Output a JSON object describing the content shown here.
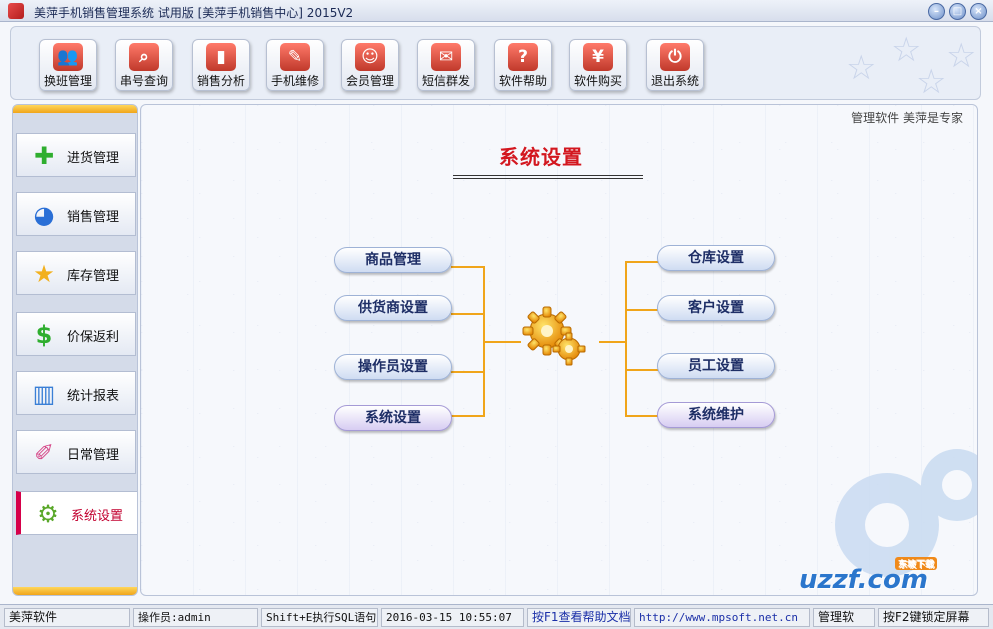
{
  "window": {
    "title": "美萍手机销售管理系统 试用版 [美萍手机销售中心] 2015V2",
    "buttons": {
      "minimize": "–",
      "restore": "□",
      "close": "×"
    }
  },
  "toolbar": {
    "items": [
      {
        "label": "换班管理",
        "icon": "users-icon",
        "glyph": "👥",
        "color": "#c0392b"
      },
      {
        "label": "串号查询",
        "icon": "search-icon",
        "glyph": "⌕",
        "color": "#c0392b"
      },
      {
        "label": "销售分析",
        "icon": "bar-chart-icon",
        "glyph": "▮",
        "color": "#c0392b"
      },
      {
        "label": "手机维修",
        "icon": "wrench-icon",
        "glyph": "✎",
        "color": "#c0392b"
      },
      {
        "label": "会员管理",
        "icon": "member-icon",
        "glyph": "☺",
        "color": "#c0392b"
      },
      {
        "label": "短信群发",
        "icon": "envelope-icon",
        "glyph": "✉",
        "color": "#c0392b"
      },
      {
        "label": "软件帮助",
        "icon": "help-icon",
        "glyph": "?",
        "color": "#c0392b"
      },
      {
        "label": "软件购买",
        "icon": "yen-icon",
        "glyph": "¥",
        "color": "#c0392b"
      },
      {
        "label": "退出系统",
        "icon": "power-icon",
        "glyph": "⏻",
        "color": "#c0392b"
      }
    ]
  },
  "sidebar": {
    "items": [
      {
        "label": "进货管理",
        "icon": "plus-icon",
        "glyph": "✚",
        "color": "#2fae2f"
      },
      {
        "label": "销售管理",
        "icon": "pie-icon",
        "glyph": "◕",
        "color": "#2a6fd6"
      },
      {
        "label": "库存管理",
        "icon": "star-icon",
        "glyph": "★",
        "color": "#f2b01e"
      },
      {
        "label": "价保返利",
        "icon": "dollar-icon",
        "glyph": "$",
        "color": "#2fae2f"
      },
      {
        "label": "统计报表",
        "icon": "report-icon",
        "glyph": "▥",
        "color": "#3a7fd6"
      },
      {
        "label": "日常管理",
        "icon": "broom-icon",
        "glyph": "✐",
        "color": "#d64a8a"
      },
      {
        "label": "系统设置",
        "icon": "gear-icon",
        "glyph": "⚙",
        "color": "#5aa82a",
        "active": true
      }
    ]
  },
  "main": {
    "slogan": "管理软件 美萍是专家",
    "heading": "系统设置",
    "left_buttons": [
      "商品管理",
      "供货商设置",
      "操作员设置",
      "系统设置"
    ],
    "right_buttons": [
      "仓库设置",
      "客户设置",
      "员工设置",
      "系统维护"
    ],
    "center_icon": "gears-icon",
    "watermark": {
      "text": "uzzf.com",
      "tag": "东坡下载"
    }
  },
  "statusbar": {
    "company": "美萍软件",
    "operator": "操作员:admin",
    "sql_hint": "Shift+E执行SQL语句",
    "datetime": "2016-03-15 10:55:07",
    "help_hint": "按F1查看帮助文档",
    "url": "http://www.mpsoft.net.cn",
    "truncated": "管理软",
    "lock_hint": "按F2键锁定屏幕"
  },
  "colors": {
    "accent": "#f0a51a",
    "heading": "#d3171f",
    "active": "#d6004a"
  }
}
